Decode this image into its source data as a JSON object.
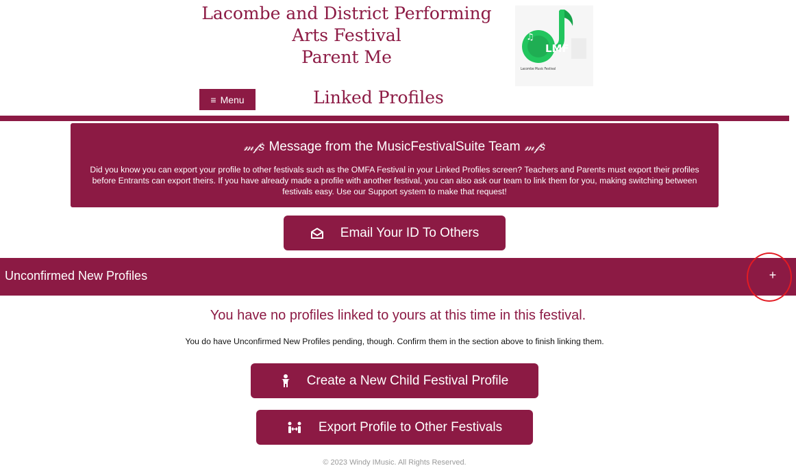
{
  "header": {
    "title_lines": [
      "Lacombe and District Performing",
      "Arts Festival",
      "Parent Me"
    ],
    "logo": {
      "mark_text": "LMF",
      "caption": "Lacombe Music Festival",
      "icon": "music-note-icon"
    },
    "menu_label": "Menu",
    "menu_icon": "hamburger-icon",
    "page_heading": "Linked Profiles"
  },
  "message": {
    "glyph": "𝓂𝒻s",
    "title": "Message from the MusicFestivalSuite Team",
    "body": "Did you know you can export your profile to other festivals such as the OMFA Festival in your Linked Profiles screen? Teachers and Parents must export their profiles before Entrants can export theirs. If you have already made a profile with another festival, you can also ask our team to link them for you, making switching between festivals easy. Use our Support system to make that request!"
  },
  "email_button": {
    "label": "Email Your ID To Others",
    "icon": "envelope-open-icon"
  },
  "accordion": {
    "label": "Unconfirmed New Profiles",
    "toggle": "+"
  },
  "notice": {
    "heading": "You have no profiles linked to yours at this time in this festival.",
    "body": "You do have Unconfirmed New Profiles pending, though. Confirm them in the section above to finish linking them."
  },
  "actions": [
    {
      "label": "Create a New Child Festival Profile",
      "icon": "child-icon"
    },
    {
      "label": "Export Profile to Other Festivals",
      "icon": "people-arrows-icon"
    }
  ],
  "footer": "© 2023 Windy IMusic. All Rights Reserved.",
  "colors": {
    "brand": "#8c1a44",
    "highlight": "#e31b23",
    "logo_green": "#22c55e"
  }
}
